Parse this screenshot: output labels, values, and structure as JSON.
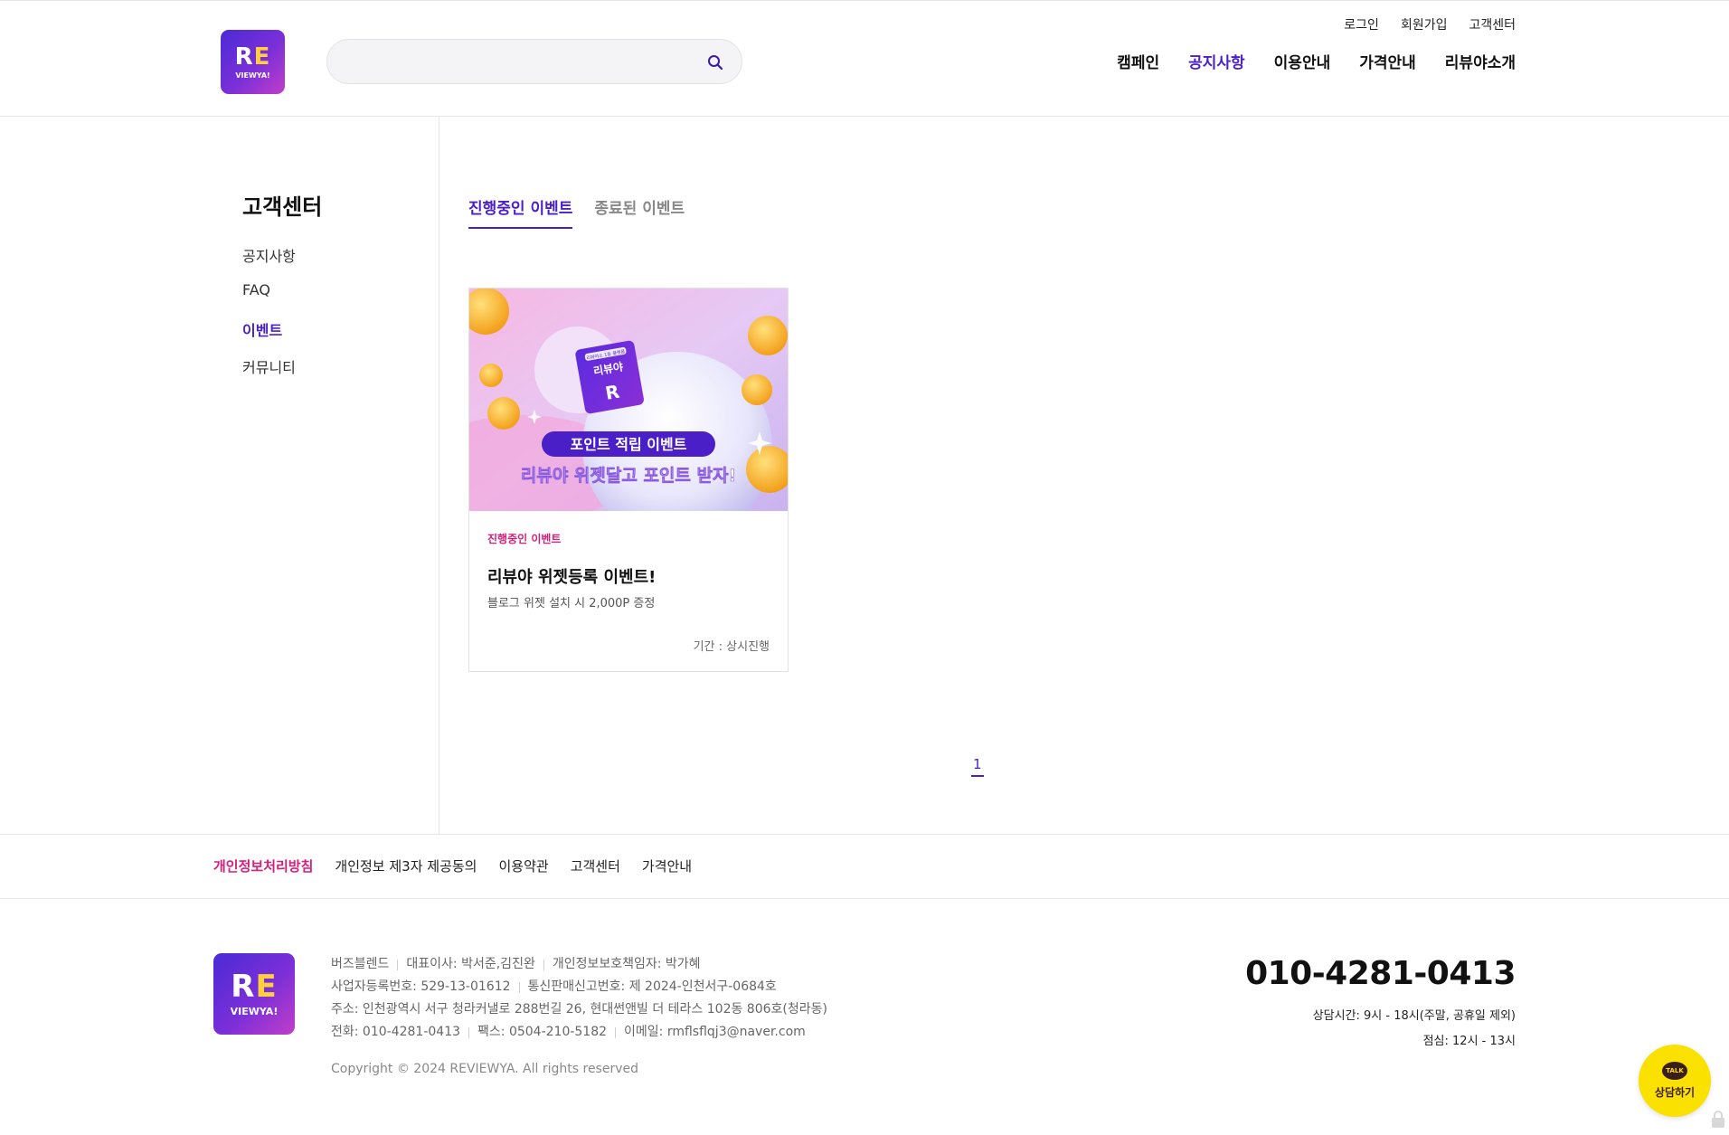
{
  "header": {
    "logo": {
      "text_top_left": "R",
      "text_top_right": "E",
      "text_bottom": "VIEWYA!"
    },
    "search": {
      "value": "",
      "placeholder": ""
    },
    "util_nav": [
      "로그인",
      "회원가입",
      "고객센터"
    ],
    "main_nav": [
      {
        "label": "캠페인",
        "active": false
      },
      {
        "label": "공지사항",
        "active": true
      },
      {
        "label": "이용안내",
        "active": false
      },
      {
        "label": "가격안내",
        "active": false
      },
      {
        "label": "리뷰야소개",
        "active": false
      }
    ]
  },
  "sidebar": {
    "title": "고객센터",
    "items": [
      {
        "label": "공지사항",
        "active": false
      },
      {
        "label": "FAQ",
        "active": false
      },
      {
        "label": "이벤트",
        "active": true
      },
      {
        "label": "커뮤니티",
        "active": false
      }
    ]
  },
  "tabs": [
    {
      "label": "진행중인 이벤트",
      "active": true
    },
    {
      "label": "종료된 이벤트",
      "active": false
    }
  ],
  "event_card": {
    "banner": {
      "badge_small": "리뷰야소 1등 플랫폼",
      "badge_big": "리뷰야",
      "pill_text": "포인트 적립 이벤트",
      "headline": "리뷰야 위젯달고 포인트 받자!"
    },
    "status": "진행중인 이벤트",
    "title": "리뷰야 위젯등록 이벤트!",
    "description": "블로그 위젯 설치 시 2,000P 증정",
    "period": "기간 : 상시진행"
  },
  "pagination": {
    "pages": [
      "1"
    ],
    "current": "1"
  },
  "footer_links": [
    {
      "label": "개인정보처리방침",
      "highlight": true
    },
    {
      "label": "개인정보 제3자 제공동의",
      "highlight": false
    },
    {
      "label": "이용약관",
      "highlight": false
    },
    {
      "label": "고객센터",
      "highlight": false
    },
    {
      "label": "가격안내",
      "highlight": false
    }
  ],
  "footer": {
    "company": "버즈블렌드",
    "ceo": "대표이사: 박서준,김진완",
    "privacy_officer": "개인정보보호책임자: 박가혜",
    "business_number": "사업자등록번호: 529-13-01612",
    "ecommerce_number": "통신판매신고번호: 제 2024-인천서구-0684호",
    "address": "주소: 인천광역시 서구 청라커낼로 288번길 26, 현대썬앤빌 더 테라스 102동 806호(청라동)",
    "phone": "전화: 010-4281-0413",
    "fax": "팩스: 0504-210-5182",
    "email": "이메일: rmflsflqj3@naver.com",
    "copyright": "Copyright © 2024 REVIEWYA. All rights reserved",
    "cs_phone": "010-4281-0413",
    "cs_hours": "상담시간: 9시 - 18시(주말, 공휴일 제외)",
    "cs_lunch": "점심: 12시 - 13시"
  },
  "kakao": {
    "bubble": "TALK",
    "label": "상담하기"
  },
  "colors": {
    "brand_purple": "#4b1fc7",
    "accent_pink": "#d4207a",
    "kakao_yellow": "#fae100"
  }
}
